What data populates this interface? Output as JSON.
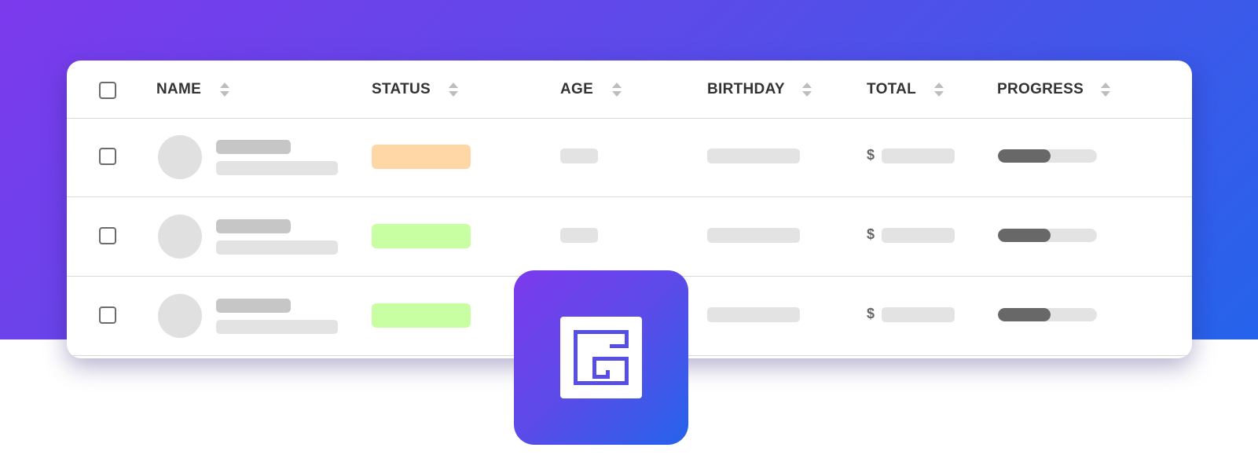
{
  "brand": {
    "gradient_start": "#7c3aed",
    "gradient_end": "#2563eb",
    "logo_icon": "grid-maze-logo-icon"
  },
  "table": {
    "columns": [
      {
        "key": "name",
        "label": "NAME"
      },
      {
        "key": "status",
        "label": "STATUS"
      },
      {
        "key": "age",
        "label": "AGE"
      },
      {
        "key": "birthday",
        "label": "BIRTHDAY"
      },
      {
        "key": "total",
        "label": "TOTAL"
      },
      {
        "key": "progress",
        "label": "PROGRESS"
      }
    ],
    "currency_symbol": "$",
    "rows": [
      {
        "status_color": "#ffd7a6",
        "progress": 0.53
      },
      {
        "status_color": "#c8ffa3",
        "progress": 0.53
      },
      {
        "status_color": "#c8ffa3",
        "progress": 0.53
      }
    ]
  }
}
